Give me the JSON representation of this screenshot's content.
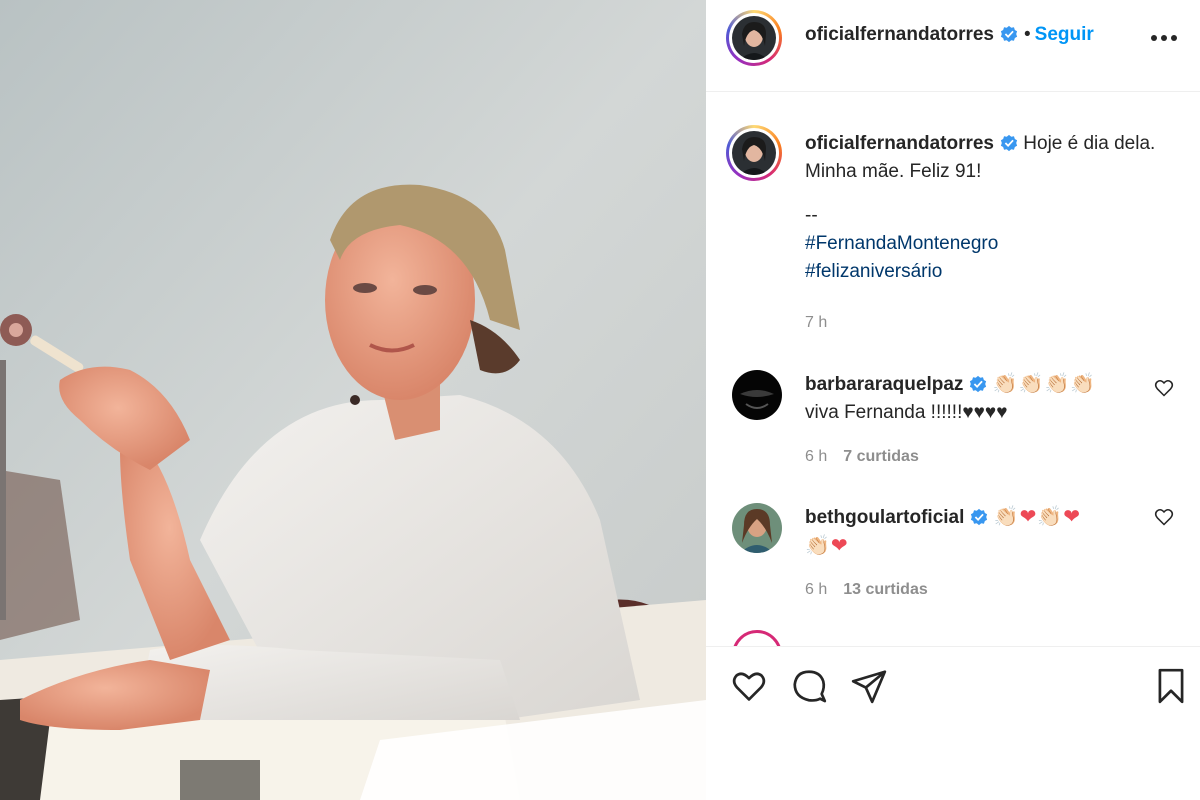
{
  "post": {
    "author": {
      "username": "oficialfernandatorres",
      "verified": true,
      "follow_label": "Seguir",
      "separator": "•"
    },
    "caption": {
      "username": "oficialfernandatorres",
      "text": "Hoje é dia dela. Minha mãe. Feliz 91!",
      "separator": "--",
      "hashtags": [
        "#FernandaMontenegro",
        "#felizaniversário"
      ],
      "time": "7 h"
    },
    "comments": [
      {
        "username": "barbararaquelpaz",
        "verified": true,
        "emoji": "👏🏻👏🏻👏🏻👏🏻",
        "text": "viva Fernanda !!!!!!♥♥♥♥",
        "time": "6 h",
        "likes": "7 curtidas"
      },
      {
        "username": "bethgoulartoficial",
        "verified": true,
        "emoji_line1": [
          "👏🏻",
          "❤",
          "👏🏻",
          "❤"
        ],
        "emoji_line2": [
          "👏🏻",
          "❤"
        ],
        "time": "6 h",
        "likes": "13 curtidas"
      }
    ],
    "icons": {
      "verified": "verified-badge-icon",
      "more": "more-options-icon",
      "like": "heart-outline-icon",
      "comment": "comment-bubble-icon",
      "share": "paper-plane-icon",
      "save": "bookmark-icon"
    },
    "colors": {
      "link_blue": "#0095f6",
      "hashtag_blue": "#00376b",
      "verified_blue": "#3897f0",
      "meta_gray": "#8e8e8e",
      "heart_red": "#ed4956"
    }
  }
}
